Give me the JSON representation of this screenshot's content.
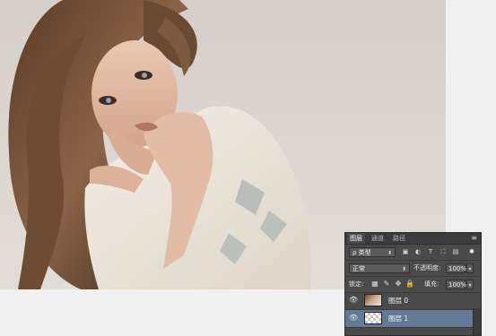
{
  "canvas": {
    "image": "photo-portrait",
    "background_color": "#ddd7d1"
  },
  "layers_panel": {
    "tabs": [
      {
        "label": "图层",
        "active": true
      },
      {
        "label": "通道",
        "active": false
      },
      {
        "label": "路径",
        "active": false
      }
    ],
    "menu_icon": "panel-menu-icon",
    "filter": {
      "kind_label": "ρ 类型",
      "icons": [
        "pixel-filter-icon",
        "adjustment-filter-icon",
        "type-filter-icon",
        "shape-filter-icon",
        "smart-object-filter-icon"
      ]
    },
    "blend_mode": "正常",
    "opacity_label": "不透明度:",
    "opacity_value": "100%",
    "lock_label": "锁定:",
    "lock_icons": [
      "lock-transparent-icon",
      "lock-paint-icon",
      "lock-move-icon",
      "lock-all-icon"
    ],
    "fill_label": "填充:",
    "fill_value": "100%",
    "layers": [
      {
        "name": "图层 0",
        "thumbnail": "photo",
        "visible": true,
        "selected": false
      },
      {
        "name": "图层 1",
        "thumbnail": "transparent",
        "visible": true,
        "selected": true
      }
    ],
    "selected_color": "#627a96"
  }
}
